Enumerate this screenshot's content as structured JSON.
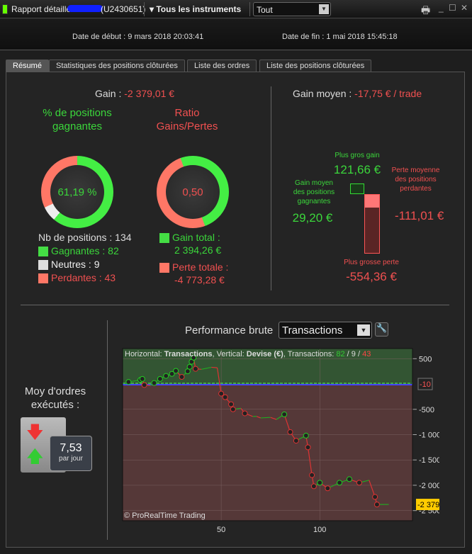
{
  "titlebar": {
    "title": "Rapport détaillé",
    "account": "(U2430651)",
    "instruments": "Tous les instruments",
    "filter": "Tout"
  },
  "dates": {
    "start": "Date de début : 9 mars 2018 20:03:41",
    "end": "Date de fin : 1 mai 2018 15:45:18"
  },
  "tabs": [
    {
      "label": "Résumé"
    },
    {
      "label": "Statistiques des positions clôturées"
    },
    {
      "label": "Liste des ordres"
    },
    {
      "label": "Liste des positions clôturées"
    }
  ],
  "summary": {
    "gain_label": "Gain :",
    "gain_value": "-2 379,01 €",
    "pct_title": "% de positions gagnantes",
    "pct_value": "61,19 %",
    "ratio_title": "Ratio Gains/Pertes",
    "ratio_value": "0,50",
    "nb_positions": "Nb de positions : 134",
    "winners": "Gagnantes : 82",
    "neutral": "Neutres : 9",
    "losers": "Perdantes : 43",
    "gain_total_label": "Gain total :",
    "gain_total": "2 394,26 €",
    "loss_total_label": "Perte totale :",
    "loss_total": "-4 773,28 €",
    "win_pct": 61.19,
    "neutral_pct": 6.72,
    "ratio_gain_share": 33.4
  },
  "average": {
    "title": "Gain moyen :",
    "value": "-17,75 € / trade",
    "biggest_gain_label": "Plus gros gain",
    "biggest_gain": "121,66 €",
    "avg_win_label": "Gain moyen des positions gagnantes",
    "avg_win": "29,20 €",
    "avg_loss_label": "Perte moyenne des positions perdantes",
    "avg_loss": "-111,01 €",
    "biggest_loss_label": "Plus grosse perte",
    "biggest_loss": "-554,36 €"
  },
  "orders": {
    "label": "Moy d'ordres exécutés :",
    "value": "7,53",
    "unit": "par jour"
  },
  "performance": {
    "label": "Performance brute",
    "select": "Transactions"
  },
  "chart_data": {
    "type": "line",
    "header_prefix": "Horizontal: ",
    "h": "Transactions",
    "mid": ", Vertical: ",
    "v": "Devise (€)",
    "tx": ", Transactions: ",
    "w": "82",
    "n": "9",
    "l": "43",
    "copyright": "© ProRealTime Trading",
    "xticks": [
      50,
      100
    ],
    "yticks": [
      500,
      -500,
      -1000,
      -1500,
      -2000,
      -2500
    ],
    "ytick_labels": [
      "500",
      "-500",
      "-1 000",
      "-1 500",
      "-2 000",
      "-2 500"
    ],
    "xlim": [
      0,
      147
    ],
    "ylim": [
      -2700,
      700
    ],
    "zero_marker": "-10",
    "last_marker": "-2 379,01",
    "points": [
      [
        1,
        0
      ],
      [
        3,
        40
      ],
      [
        9,
        80
      ],
      [
        10,
        100
      ],
      [
        11,
        -20
      ],
      [
        14,
        -30
      ],
      [
        16,
        20
      ],
      [
        19,
        100
      ],
      [
        22,
        160
      ],
      [
        25,
        200
      ],
      [
        27,
        260
      ],
      [
        30,
        140
      ],
      [
        33,
        250
      ],
      [
        34,
        340
      ],
      [
        35,
        440
      ],
      [
        36,
        520
      ],
      [
        37,
        300
      ],
      [
        40,
        290
      ],
      [
        45,
        330
      ],
      [
        48,
        320
      ],
      [
        50,
        -190
      ],
      [
        52,
        -260
      ],
      [
        55,
        -400
      ],
      [
        56,
        -500
      ],
      [
        60,
        -480
      ],
      [
        62,
        -580
      ],
      [
        66,
        -640
      ],
      [
        68,
        -640
      ],
      [
        70,
        -670
      ],
      [
        75,
        -660
      ],
      [
        78,
        -700
      ],
      [
        82,
        -600
      ],
      [
        85,
        -950
      ],
      [
        88,
        -1120
      ],
      [
        93,
        -1020
      ],
      [
        94,
        -1250
      ],
      [
        96,
        -1800
      ],
      [
        97,
        -2020
      ],
      [
        100,
        -1950
      ],
      [
        104,
        -2060
      ],
      [
        110,
        -1950
      ],
      [
        115,
        -1880
      ],
      [
        120,
        -1950
      ],
      [
        125,
        -1900
      ],
      [
        128,
        -2230
      ],
      [
        129,
        -2380
      ],
      [
        135,
        -2379
      ]
    ]
  }
}
